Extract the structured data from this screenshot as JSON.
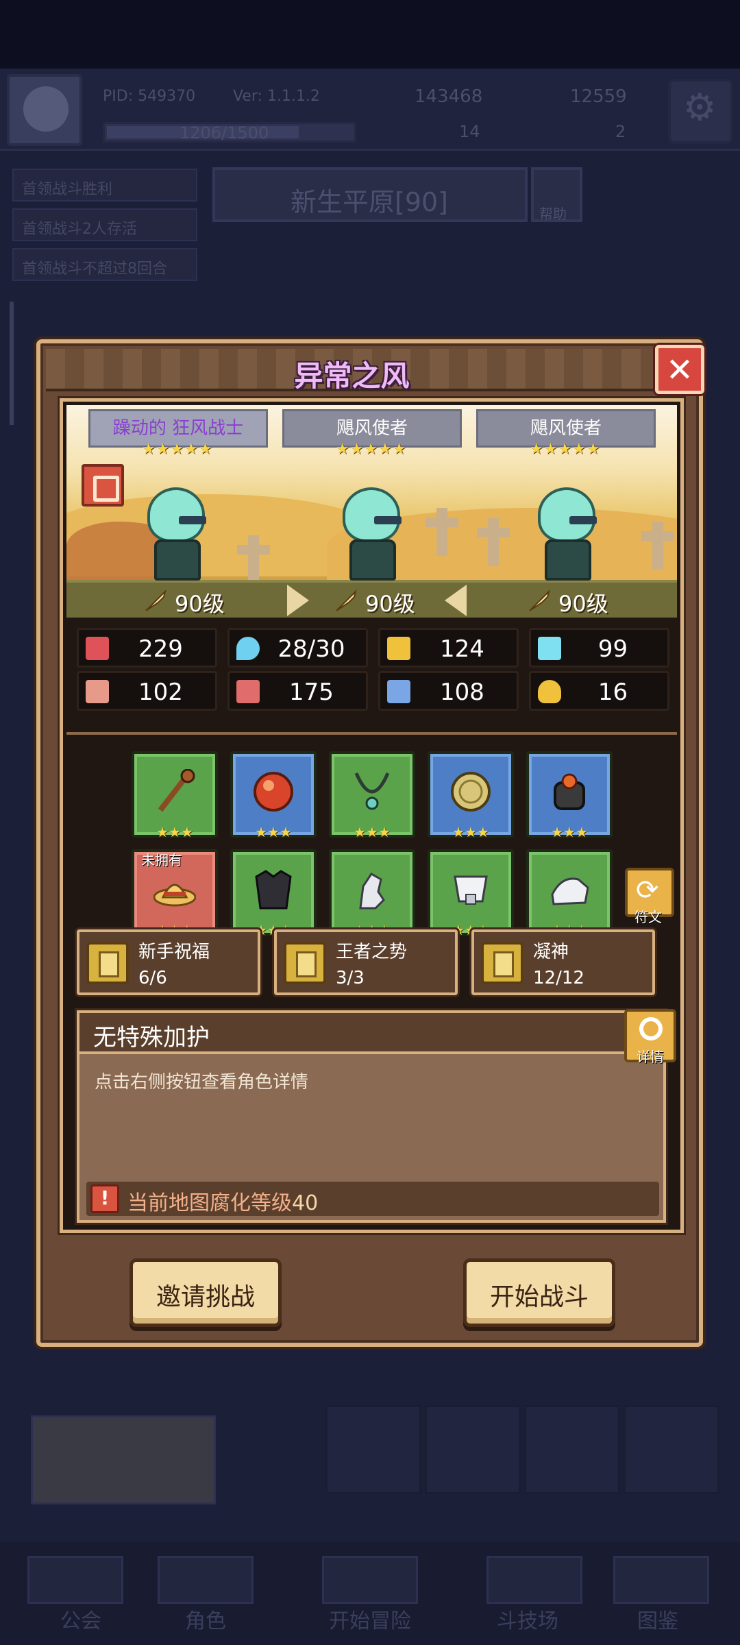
{
  "background": {
    "pid": "PID: 549370",
    "version": "Ver: 1.1.1.2",
    "gold": "143468",
    "gems": "12559",
    "exp": "1206/1500",
    "clover": "14",
    "keys": "2",
    "quests": [
      "首领战斗胜利",
      "首领战斗2人存活",
      "首领战斗不超过8回合"
    ],
    "stage": "新生平原[90]",
    "help": "帮助",
    "nav": [
      "公会",
      "角色",
      "开始冒险",
      "斗技场",
      "图鉴"
    ]
  },
  "modal": {
    "title": "异常之风",
    "close_icon": "close-icon",
    "heroes": [
      {
        "name_prefix": "躁动的",
        "name": "狂风战士",
        "stars": "★★★★★",
        "level": "90级"
      },
      {
        "name": "飓风使者",
        "stars": "★★★★★",
        "level": "90级"
      },
      {
        "name": "飓风使者",
        "stars": "★★★★★",
        "level": "90级"
      }
    ],
    "stats": [
      {
        "icon": "heart-icon",
        "value": "229",
        "color": "#e0525a"
      },
      {
        "icon": "mana-drop-icon",
        "value": "28/30",
        "color": "#6fd0f0"
      },
      {
        "icon": "shield-icon",
        "value": "124",
        "color": "#f0c23c"
      },
      {
        "icon": "crystal-icon",
        "value": "99",
        "color": "#7ee0f0"
      },
      {
        "icon": "fist-icon",
        "value": "102",
        "color": "#e89a8a"
      },
      {
        "icon": "book-icon",
        "value": "175",
        "color": "#e06c6c"
      },
      {
        "icon": "boot-icon",
        "value": "108",
        "color": "#7aa6e6"
      },
      {
        "icon": "horseshoe-icon",
        "value": "16",
        "color": "#f0c23c"
      }
    ],
    "equipment": [
      {
        "icon": "staff-icon",
        "stars": "★★★",
        "rarity": "green"
      },
      {
        "icon": "fire-orb-icon",
        "stars": "★★★",
        "rarity": "blue"
      },
      {
        "icon": "necklace-icon",
        "stars": "★★★",
        "rarity": "green"
      },
      {
        "icon": "coin-icon",
        "stars": "★★★",
        "rarity": "blue"
      },
      {
        "icon": "ring-icon",
        "stars": "★★★",
        "rarity": "blue"
      },
      {
        "icon": "straw-hat-icon",
        "stars": "★★★",
        "rarity": "red",
        "badge": "未拥有"
      },
      {
        "icon": "armor-icon",
        "stars": "★★★",
        "rarity": "green"
      },
      {
        "icon": "gloves-icon",
        "stars": "★★★",
        "rarity": "green"
      },
      {
        "icon": "belt-icon",
        "stars": "★★★",
        "rarity": "green"
      },
      {
        "icon": "boots-icon",
        "stars": "★★★",
        "rarity": "green"
      }
    ],
    "rune_label": "符文",
    "buffs": [
      {
        "name": "新手祝福",
        "count": "6/6"
      },
      {
        "name": "王者之势",
        "count": "3/3"
      },
      {
        "name": "凝神",
        "count": "12/12"
      }
    ],
    "protection": {
      "title": "无特殊加护",
      "detail_label": "详情",
      "hint": "点击右侧按钮查看角色详情",
      "corruption_text": "当前地图腐化等级",
      "corruption_level": "40"
    },
    "invite_label": "邀请挑战",
    "start_label": "开始战斗"
  }
}
